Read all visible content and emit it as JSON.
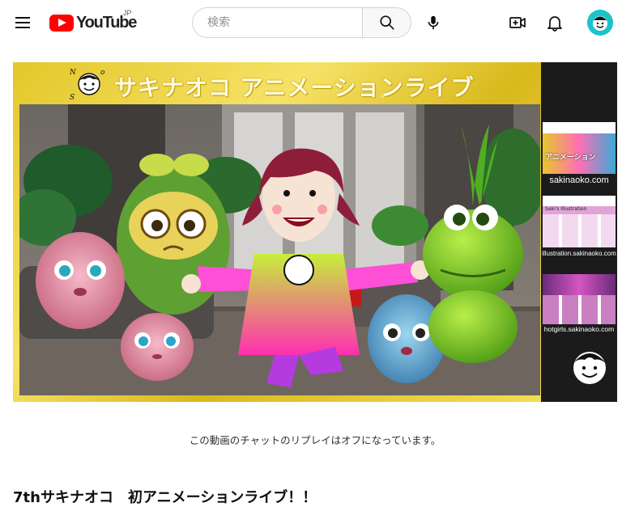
{
  "header": {
    "logo_text": "YouTube",
    "region": "JP",
    "search_placeholder": "検索",
    "avatar_text": "NAOKO SAKI"
  },
  "player": {
    "banner_title": "サキナオコ アニメーションライブ",
    "logo_text": "Naoko SAKI",
    "side_labels": [
      "sakinaoko.com",
      "illustration.sakinaoko.com",
      "hotgirls.sakinaoko.com"
    ],
    "side_card_titles": [
      "アニメーション",
      "Saki's Illustration"
    ]
  },
  "chat_notice": "この動画のチャットのリプレイはオフになっています。",
  "video_title": "7thサキナオコ　初アニメーションライブ！！",
  "colors": {
    "brand_red": "#ff0000",
    "frame_gold": "#e3c72a",
    "avatar_bg": "#1cc3c9"
  }
}
